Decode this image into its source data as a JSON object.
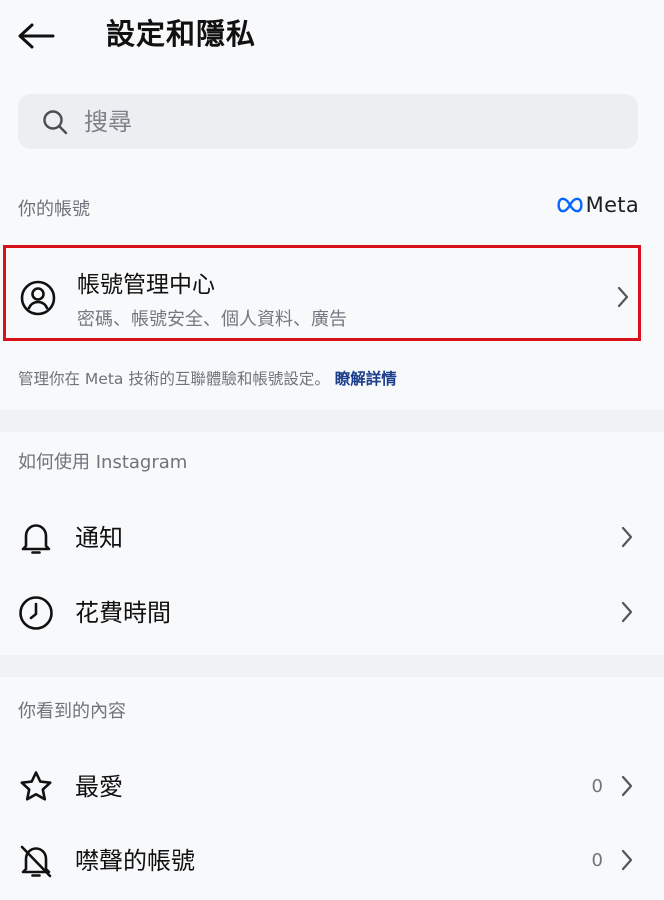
{
  "header": {
    "title": "設定和隱私",
    "back_icon": "arrow-left-icon"
  },
  "search": {
    "placeholder": "搜尋",
    "value": ""
  },
  "account_section": {
    "label": "你的帳號",
    "brand": "Meta",
    "card": {
      "title": "帳號管理中心",
      "subtitle": "密碼、帳號安全、個人資料、廣告",
      "highlight_color": "#d9111b"
    },
    "description": "管理你在 Meta 技術的互聯體驗和帳號設定。",
    "learn_more": "瞭解詳情"
  },
  "usage_section": {
    "label": "如何使用 Instagram",
    "items": [
      {
        "label": "通知",
        "icon": "bell-icon"
      },
      {
        "label": "花費時間",
        "icon": "clock-icon"
      }
    ]
  },
  "content_section": {
    "label": "你看到的內容",
    "items": [
      {
        "label": "最愛",
        "count": "0",
        "icon": "star-icon"
      },
      {
        "label": "噤聲的帳號",
        "count": "0",
        "icon": "bell-muted-icon"
      }
    ]
  },
  "colors": {
    "background": "#f8f9fb",
    "link": "#1a3e8a",
    "muted_text": "#6f737b"
  }
}
